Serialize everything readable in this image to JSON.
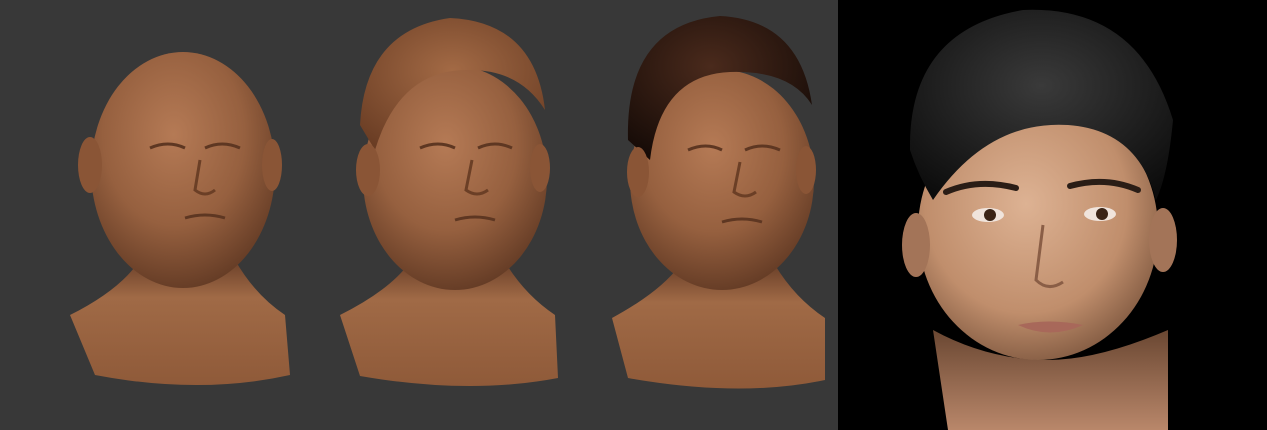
{
  "scene": {
    "viewport_background": "#383838",
    "render_background": "#000000",
    "clay_color": "#9a6442",
    "clay_shadow": "#5a3520",
    "hair_sculpt_color": "#8a5636",
    "hair_dark_color": "#2a1610",
    "skin_color": "#c99a78",
    "render_hair_color": "#1a1a1a"
  },
  "panels": [
    {
      "name": "bald-sculpt",
      "description_icon": "head-sculpt-icon"
    },
    {
      "name": "hair-block-sculpt",
      "description_icon": "head-sculpt-icon"
    },
    {
      "name": "dark-hair-sculpt",
      "description_icon": "head-sculpt-icon"
    },
    {
      "name": "final-render",
      "description_icon": "head-render-icon"
    }
  ]
}
